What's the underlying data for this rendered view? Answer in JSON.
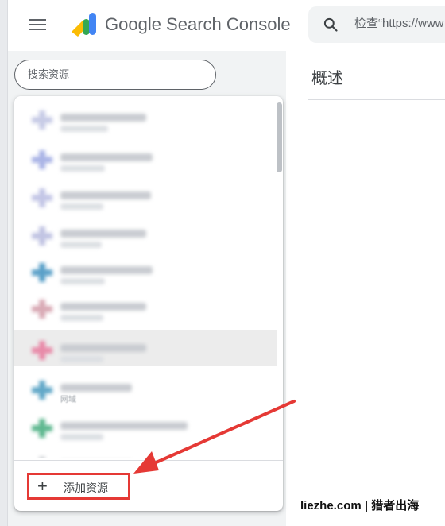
{
  "header": {
    "product_name": "Google Search Console",
    "search_placeholder": "检查“https://www",
    "logo": "search-console-logo",
    "menu_icon": "hamburger-icon",
    "search_icon": "search-icon"
  },
  "property_search": {
    "placeholder": "搜索资源"
  },
  "main": {
    "title": "概述"
  },
  "dropdown": {
    "items": [
      {
        "favicon_color": "#c7cbe6",
        "sub": ""
      },
      {
        "favicon_color": "#aab4e6",
        "sub": ""
      },
      {
        "favicon_color": "#c3c6e6",
        "sub": ""
      },
      {
        "favicon_color": "#c1c4e3",
        "sub": ""
      },
      {
        "favicon_color": "#5aa0c8",
        "sub": ""
      },
      {
        "favicon_color": "#d9aab5",
        "sub": ""
      },
      {
        "favicon_color": "#e88aa8",
        "sub": "",
        "selected": true
      },
      {
        "favicon_color": "#62a8c8",
        "sub": "网域"
      },
      {
        "favicon_color": "#5fb890",
        "sub": ""
      },
      {
        "favicon_color": "#c9ccd1",
        "sub": ""
      }
    ],
    "add_property_label": "添加资源",
    "add_icon": "plus-icon"
  },
  "watermark": {
    "text": "liezhe.com | 猎者出海"
  },
  "colors": {
    "highlight_box": "#e53935",
    "arrow": "#e53935",
    "brand_yellow": "#fbbc04",
    "brand_blue": "#4285f4"
  }
}
